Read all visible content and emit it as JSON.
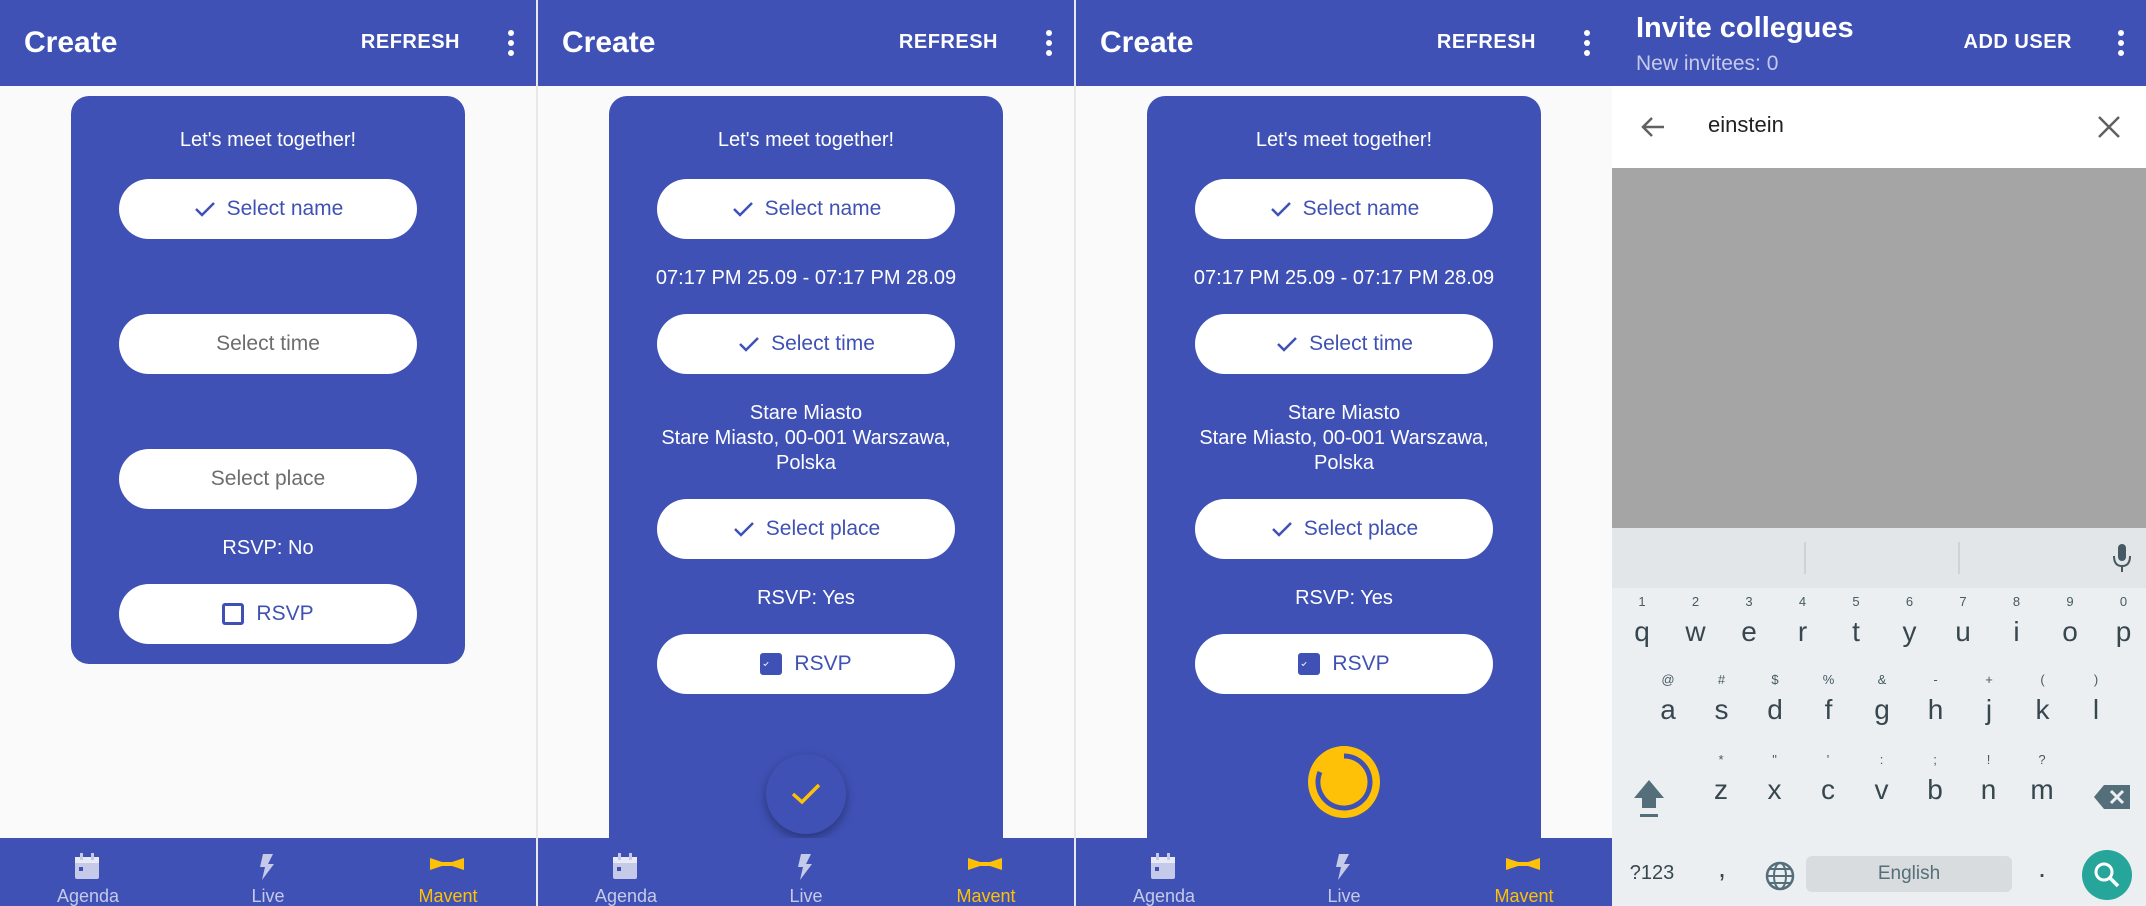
{
  "colors": {
    "primary": "#3f51b5",
    "accent": "#ffc107",
    "white": "#ffffff"
  },
  "create_screen": {
    "title": "Create",
    "refresh_label": "REFRESH",
    "heading": "Let's meet together!",
    "select_name": "Select name",
    "select_time": "Select time",
    "select_place": "Select place",
    "rsvp_button": "RSVP"
  },
  "panels": [
    {
      "rsvp_status": "RSVP: No",
      "rsvp_checked": false
    },
    {
      "time_range": "07:17 PM 25.09 - 07:17 PM 28.09",
      "place_name": "Stare Miasto",
      "place_address_line1": "Stare Miasto, 00-001 Warszawa,",
      "place_address_line2": "Polska",
      "rsvp_status": "RSVP: Yes",
      "rsvp_checked": true,
      "fab_icon": "check-icon"
    },
    {
      "time_range": "07:17 PM 25.09 - 07:17 PM 28.09",
      "place_name": "Stare Miasto",
      "place_address_line1": "Stare Miasto, 00-001 Warszawa,",
      "place_address_line2": "Polska",
      "rsvp_status": "RSVP: Yes",
      "rsvp_checked": true,
      "fab_icon": "loading-spinner-icon"
    }
  ],
  "bottom_nav": [
    {
      "label": "Agenda",
      "icon": "calendar-icon"
    },
    {
      "label": "Live",
      "icon": "lightning-icon"
    },
    {
      "label": "Mavent",
      "icon": "ribbon-icon",
      "active": true
    }
  ],
  "invite_screen": {
    "title": "Invite collegues",
    "subtitle": "New invitees: 0",
    "add_user_label": "ADD USER",
    "search_query": "einstein"
  },
  "keyboard": {
    "row1": [
      [
        "q",
        "1"
      ],
      [
        "w",
        "2"
      ],
      [
        "e",
        "3"
      ],
      [
        "r",
        "4"
      ],
      [
        "t",
        "5"
      ],
      [
        "y",
        "6"
      ],
      [
        "u",
        "7"
      ],
      [
        "i",
        "8"
      ],
      [
        "o",
        "9"
      ],
      [
        "p",
        "0"
      ]
    ],
    "row2": [
      [
        "a",
        "@"
      ],
      [
        "s",
        "#"
      ],
      [
        "d",
        "$"
      ],
      [
        "f",
        "%"
      ],
      [
        "g",
        "&"
      ],
      [
        "h",
        "-"
      ],
      [
        "j",
        "+"
      ],
      [
        "k",
        "("
      ],
      [
        "l",
        ")"
      ]
    ],
    "row3": [
      [
        "z",
        "*"
      ],
      [
        "x",
        "\""
      ],
      [
        "c",
        "'"
      ],
      [
        "v",
        ":"
      ],
      [
        "b",
        ";"
      ],
      [
        "n",
        "!"
      ],
      [
        "m",
        "?"
      ]
    ],
    "symbols_key": "?123",
    "comma_key": ",",
    "space_label": "English",
    "period_key": "."
  }
}
